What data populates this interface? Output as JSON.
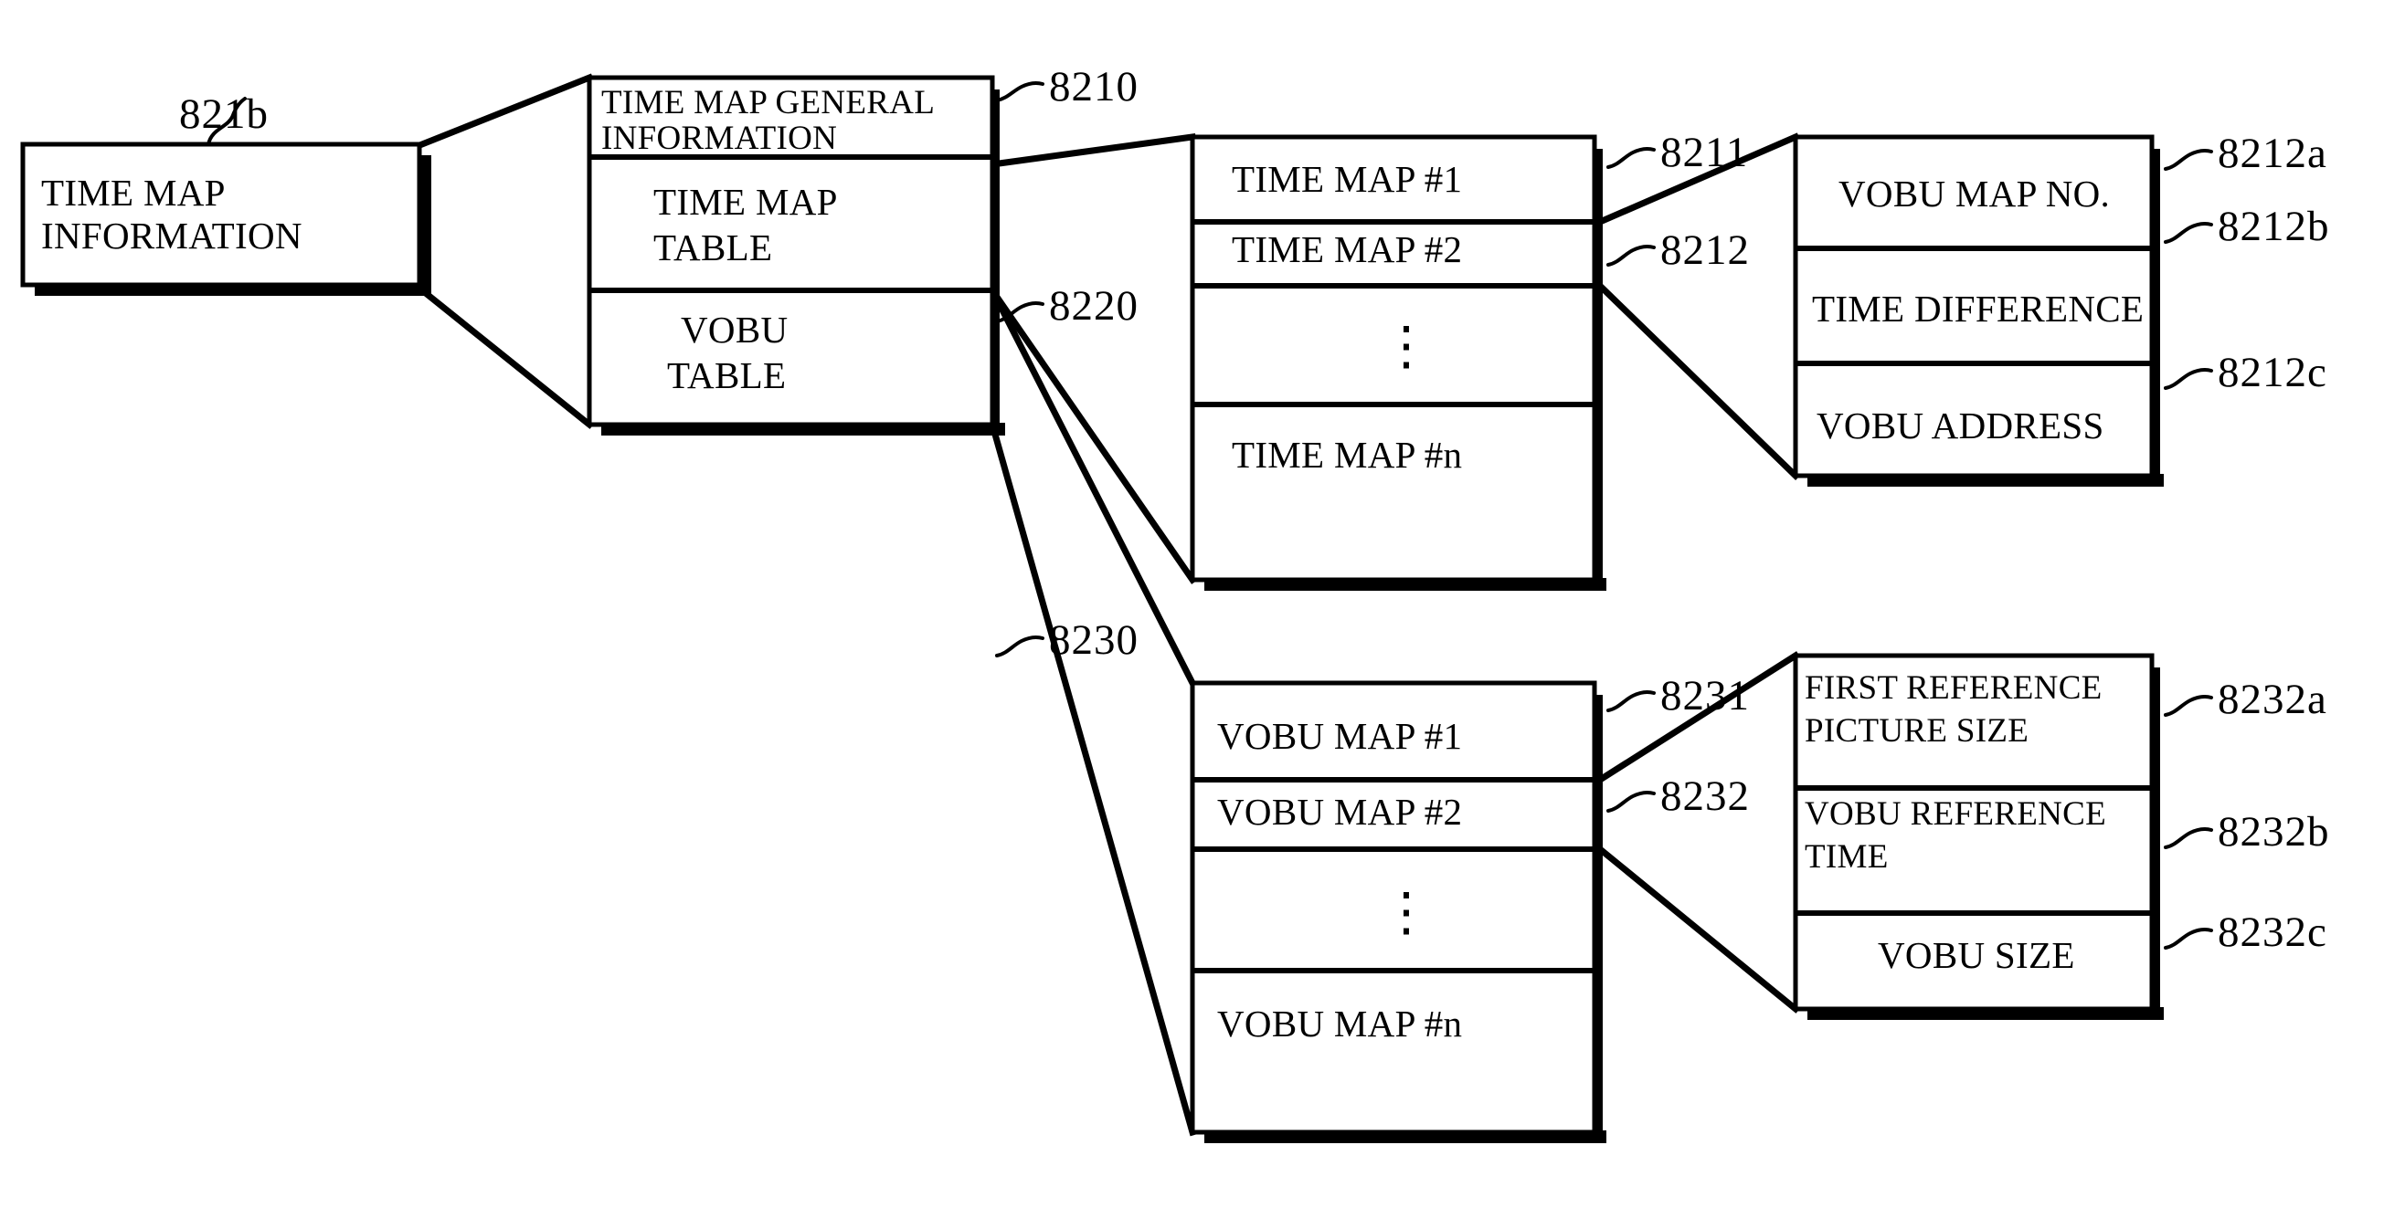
{
  "figure": {
    "type": "patent-block-diagram",
    "title": "TIME MAP INFORMATION data structure"
  },
  "boxes": {
    "time_map_information": {
      "ref": "821b",
      "rows": [
        {
          "line1": "TIME MAP",
          "line2": "INFORMATION"
        }
      ]
    },
    "time_map_info_detail": {
      "rows": [
        {
          "ref": "8210",
          "line1": "TIME MAP GENERAL",
          "line2": "INFORMATION"
        },
        {
          "ref": "8220",
          "line1": "TIME MAP",
          "line2": "TABLE"
        },
        {
          "ref": "8230",
          "line1": "VOBU",
          "line2": "TABLE"
        }
      ]
    },
    "time_map_table": {
      "rows": [
        {
          "ref": "8211",
          "label": "TIME MAP #1"
        },
        {
          "ref": "8212",
          "label": "TIME MAP #2"
        },
        {
          "label": "⋮"
        },
        {
          "label": "TIME MAP #n"
        }
      ]
    },
    "time_map_entry": {
      "rows": [
        {
          "ref": "8212a",
          "label": "VOBU MAP NO."
        },
        {
          "ref": "8212b",
          "label": "TIME DIFFERENCE"
        },
        {
          "ref": "8212c",
          "label": "VOBU ADDRESS"
        }
      ]
    },
    "vobu_table": {
      "rows": [
        {
          "ref": "8231",
          "label": "VOBU MAP #1"
        },
        {
          "ref": "8232",
          "label": "VOBU MAP #2"
        },
        {
          "label": "⋮"
        },
        {
          "label": "VOBU MAP #n"
        }
      ]
    },
    "vobu_map_entry": {
      "rows": [
        {
          "ref": "8232a",
          "line1": "FIRST REFERENCE",
          "line2": "PICTURE SIZE"
        },
        {
          "ref": "8232b",
          "line1": "VOBU REFERENCE",
          "line2": "TIME"
        },
        {
          "ref": "8232c",
          "line1": "VOBU SIZE",
          "line2": ""
        }
      ]
    }
  },
  "reference_numerals": [
    "821b",
    "8210",
    "8220",
    "8230",
    "8211",
    "8212",
    "8231",
    "8232",
    "8212a",
    "8212b",
    "8212c",
    "8232a",
    "8232b",
    "8232c"
  ],
  "colors": {
    "ink": "#000000",
    "paper": "#ffffff"
  }
}
